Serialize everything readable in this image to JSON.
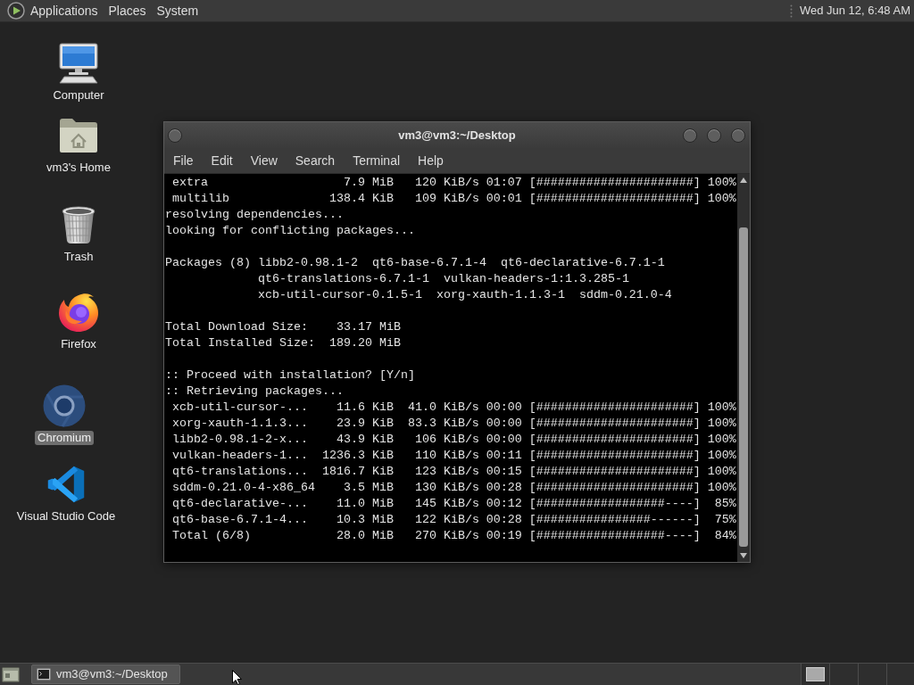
{
  "top_panel": {
    "menus": [
      "Applications",
      "Places",
      "System"
    ],
    "clock": "Wed Jun 12, 6:48 AM"
  },
  "desktop_icons": [
    {
      "label": "Computer",
      "selected": false
    },
    {
      "label": "vm3's Home",
      "selected": false
    },
    {
      "label": "Trash",
      "selected": false
    },
    {
      "label": "Firefox",
      "selected": false
    },
    {
      "label": "Chromium",
      "selected": true
    },
    {
      "label": "Visual Studio Code",
      "selected": false
    }
  ],
  "terminal": {
    "title": "vm3@vm3:~/Desktop",
    "menu": [
      "File",
      "Edit",
      "View",
      "Search",
      "Terminal",
      "Help"
    ],
    "output": [
      {
        "kind": "progress",
        "name": "extra",
        "size": "7.9 MiB",
        "rate": "120 KiB/s",
        "time": "01:07",
        "bar": "[######################]",
        "percent": "100%"
      },
      {
        "kind": "progress",
        "name": "multilib",
        "size": "138.4 KiB",
        "rate": "109 KiB/s",
        "time": "00:01",
        "bar": "[######################]",
        "percent": "100%"
      },
      {
        "kind": "text",
        "text": "resolving dependencies..."
      },
      {
        "kind": "text",
        "text": "looking for conflicting packages..."
      },
      {
        "kind": "blank"
      },
      {
        "kind": "list",
        "label": "Packages (8)",
        "lines": [
          "libb2-0.98.1-2  qt6-base-6.7.1-4  qt6-declarative-6.7.1-1",
          "qt6-translations-6.7.1-1  vulkan-headers-1:1.3.285-1",
          "xcb-util-cursor-0.1.5-1  xorg-xauth-1.1.3-1  sddm-0.21.0-4"
        ]
      },
      {
        "kind": "blank"
      },
      {
        "kind": "field",
        "label": "Total Download Size:",
        "value": "33.17 MiB"
      },
      {
        "kind": "field",
        "label": "Total Installed Size:",
        "value": "189.20 MiB"
      },
      {
        "kind": "blank"
      },
      {
        "kind": "text",
        "text": ":: Proceed with installation? [Y/n]"
      },
      {
        "kind": "text",
        "text": ":: Retrieving packages..."
      },
      {
        "kind": "progress",
        "name": "xcb-util-cursor-...",
        "size": "11.6 KiB",
        "rate": "41.0 KiB/s",
        "time": "00:00",
        "bar": "[######################]",
        "percent": "100%"
      },
      {
        "kind": "progress",
        "name": "xorg-xauth-1.1.3...",
        "size": "23.9 KiB",
        "rate": "83.3 KiB/s",
        "time": "00:00",
        "bar": "[######################]",
        "percent": "100%"
      },
      {
        "kind": "progress",
        "name": "libb2-0.98.1-2-x...",
        "size": "43.9 KiB",
        "rate": "106 KiB/s",
        "time": "00:00",
        "bar": "[######################]",
        "percent": "100%"
      },
      {
        "kind": "progress",
        "name": "vulkan-headers-1...",
        "size": "1236.3 KiB",
        "rate": "110 KiB/s",
        "time": "00:11",
        "bar": "[######################]",
        "percent": "100%"
      },
      {
        "kind": "progress",
        "name": "qt6-translations...",
        "size": "1816.7 KiB",
        "rate": "123 KiB/s",
        "time": "00:15",
        "bar": "[######################]",
        "percent": "100%"
      },
      {
        "kind": "progress",
        "name": "sddm-0.21.0-4-x86_64",
        "size": "3.5 MiB",
        "rate": "130 KiB/s",
        "time": "00:28",
        "bar": "[######################]",
        "percent": "100%"
      },
      {
        "kind": "progress",
        "name": "qt6-declarative-...",
        "size": "11.0 MiB",
        "rate": "145 KiB/s",
        "time": "00:12",
        "bar": "[##################----]",
        "percent": "85%"
      },
      {
        "kind": "progress",
        "name": "qt6-base-6.7.1-4...",
        "size": "10.3 MiB",
        "rate": "122 KiB/s",
        "time": "00:28",
        "bar": "[################------]",
        "percent": "75%"
      },
      {
        "kind": "progress",
        "name": "Total (6/8)",
        "size": "28.0 MiB",
        "rate": "270 KiB/s",
        "time": "00:19",
        "bar": "[##################----]",
        "percent": "84%"
      }
    ]
  },
  "taskbar": {
    "tasks": [
      {
        "title": "vm3@vm3:~/Desktop",
        "selected": true
      }
    ]
  }
}
